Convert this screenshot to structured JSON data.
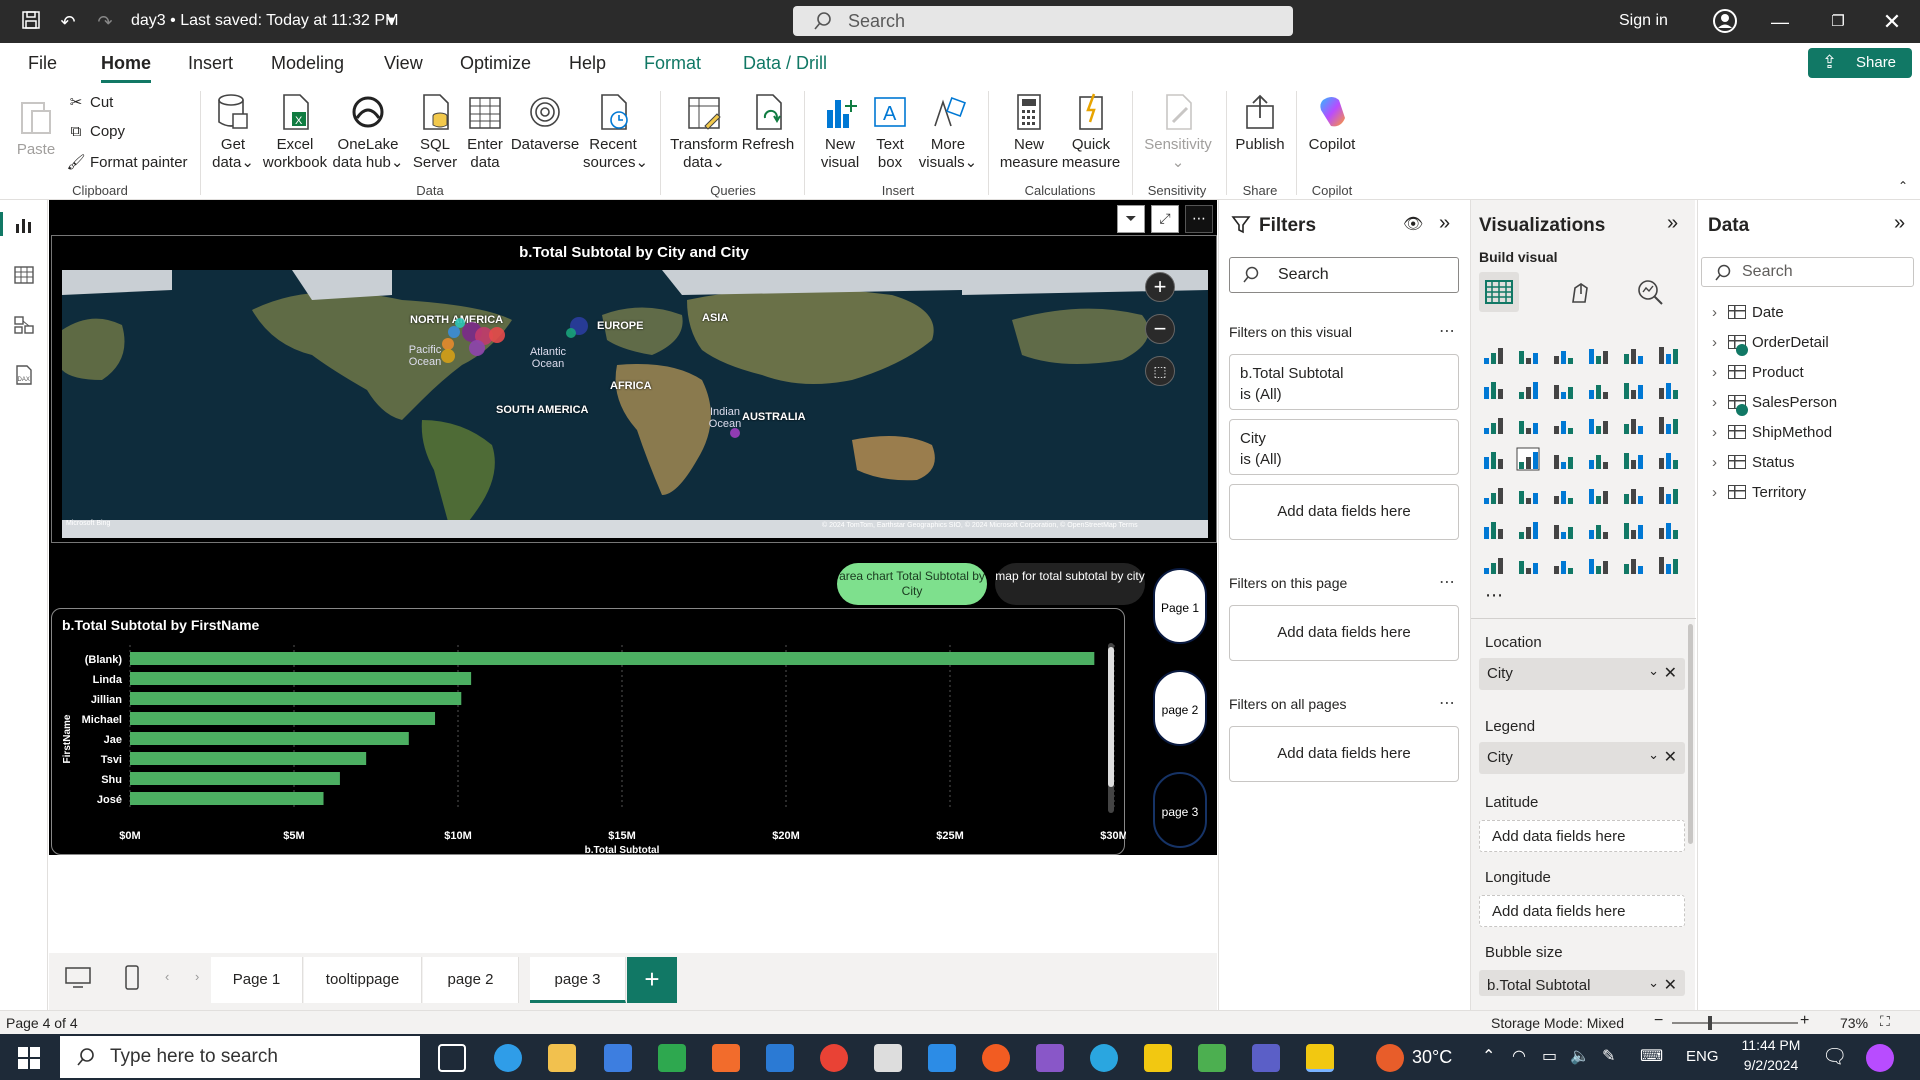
{
  "titlebar": {
    "file_title": "day3 • Last saved: Today at 11:32 PM",
    "search_placeholder": "Search",
    "sign_in": "Sign in"
  },
  "ribbon_tabs": [
    "File",
    "Home",
    "Insert",
    "Modeling",
    "View",
    "Optimize",
    "Help",
    "Format",
    "Data / Drill"
  ],
  "share_label": "Share",
  "clipboard": {
    "paste": "Paste",
    "cut": "Cut",
    "copy": "Copy",
    "format_painter": "Format painter",
    "group": "Clipboard"
  },
  "data_group": {
    "get_data": [
      "Get",
      "data"
    ],
    "excel": [
      "Excel",
      "workbook"
    ],
    "onelake": [
      "OneLake",
      "data hub"
    ],
    "sql": [
      "SQL",
      "Server"
    ],
    "enter": [
      "Enter",
      "data"
    ],
    "dataverse": [
      "Dataverse"
    ],
    "recent": [
      "Recent",
      "sources"
    ],
    "group": "Data"
  },
  "queries_group": {
    "transform": [
      "Transform",
      "data"
    ],
    "refresh": [
      "Refresh"
    ],
    "group": "Queries"
  },
  "insert_group": {
    "new_visual": [
      "New",
      "visual"
    ],
    "text_box": [
      "Text",
      "box"
    ],
    "more_visuals": [
      "More",
      "visuals"
    ],
    "group": "Insert"
  },
  "calc_group": {
    "new_measure": [
      "New",
      "measure"
    ],
    "quick_measure": [
      "Quick",
      "measure"
    ],
    "group": "Calculations"
  },
  "sensitivity_group": {
    "label": "Sensitivity",
    "group": "Sensitivity"
  },
  "share_group": {
    "publish": "Publish",
    "group": "Share"
  },
  "copilot_group": {
    "copilot": "Copilot",
    "group": "Copilot"
  },
  "map_visual": {
    "title": "b.Total Subtotal by City and City",
    "continents": [
      "NORTH AMERICA",
      "EUROPE",
      "ASIA",
      "AFRICA",
      "SOUTH AMERICA",
      "AUSTRALIA"
    ],
    "oceans": [
      "Pacific Ocean",
      "Atlantic Ocean",
      "Indian Ocean"
    ],
    "attribution": "© 2024 TomTom, Earthstar Geographics SIO, © 2024 Microsoft Corporation, © OpenStreetMap Terms",
    "bing": "Microsoft Bing"
  },
  "buttons": {
    "area_chart": "area chart Total Subtotal by City",
    "map_subtotal": "map for total subtotal by city",
    "page1": "Page 1",
    "page2": "page 2",
    "page3": "page 3"
  },
  "chart_data": {
    "type": "bar",
    "title": "b.Total Subtotal by FirstName",
    "xlabel": "b.Total Subtotal",
    "ylabel": "FirstName",
    "categories": [
      "(Blank)",
      "Linda",
      "Jillian",
      "Michael",
      "Jae",
      "Tsvi",
      "Shu",
      "José"
    ],
    "values": [
      29.4,
      10.4,
      10.1,
      9.3,
      8.5,
      7.2,
      6.4,
      5.9
    ],
    "xticks": [
      "$0M",
      "$5M",
      "$10M",
      "$15M",
      "$20M",
      "$25M",
      "$30M"
    ],
    "xlim": [
      0,
      30
    ],
    "bar_color": "#4caf62",
    "grid": true
  },
  "page_tabs": [
    "Page 1",
    "tooltippage",
    "page 2",
    "page 3"
  ],
  "filters": {
    "title": "Filters",
    "search": "Search",
    "on_visual": "Filters on this visual",
    "card1_name": "b.Total Subtotal",
    "card1_val": "is (All)",
    "card2_name": "City",
    "card2_val": "is (All)",
    "add_fields": "Add data fields here",
    "on_page": "Filters on this page",
    "on_all": "Filters on all pages"
  },
  "viz": {
    "title": "Visualizations",
    "build": "Build visual",
    "location": "Location",
    "location_field": "City",
    "legend": "Legend",
    "legend_field": "City",
    "latitude": "Latitude",
    "longitude": "Longitude",
    "bubble_size": "Bubble size",
    "bubble_field": "b.Total Subtotal",
    "add_fields": "Add data fields here"
  },
  "data_pane": {
    "title": "Data",
    "search": "Search",
    "tables": [
      "Date",
      "OrderDetail",
      "Product",
      "SalesPerson",
      "ShipMethod",
      "Status",
      "Territory"
    ]
  },
  "status": {
    "page": "Page 4 of 4",
    "storage": "Storage Mode: Mixed",
    "zoom": "73%"
  },
  "taskbar": {
    "search": "Type here to search",
    "temp": "30°C",
    "lang": "ENG",
    "time": "11:44 PM",
    "date": "9/2/2024"
  }
}
